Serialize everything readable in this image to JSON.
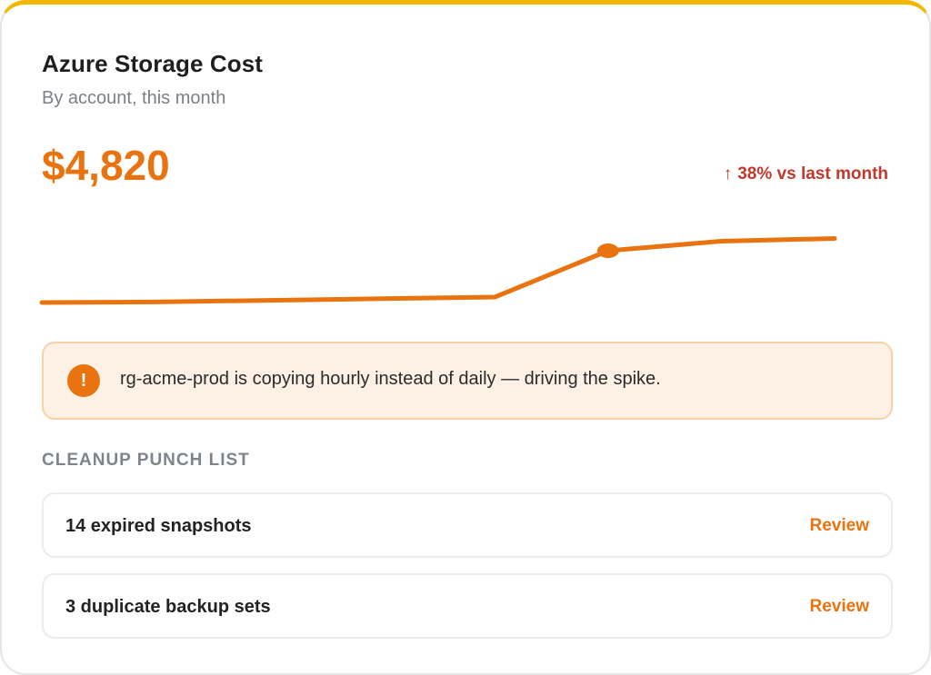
{
  "card": {
    "title": "Azure Storage Cost",
    "subtitle": "By account, this month",
    "total": "$4,820",
    "delta_arrow": "↑",
    "delta_text": "38% vs last month",
    "accent_color": "#e8730f",
    "top_border_color": "#f2b705",
    "delta_color": "#c0392b"
  },
  "alert": {
    "icon": "exclamation-icon",
    "text": "rg-acme-prod is copying hourly instead of daily — driving the spike."
  },
  "punch_list": {
    "heading": "CLEANUP PUNCH LIST",
    "items": [
      {
        "label": "14 expired snapshots",
        "action": "Review"
      },
      {
        "label": "3 duplicate backup sets",
        "action": "Review"
      }
    ]
  },
  "chart_data": {
    "type": "line",
    "x": [
      1,
      2,
      3,
      4,
      5,
      6,
      7,
      8
    ],
    "values": [
      4.0,
      4.2,
      4.8,
      5.4,
      6.0,
      23.0,
      26.5,
      27.5
    ],
    "ylim": [
      0,
      40
    ],
    "highlight_index": 5,
    "grid": false,
    "title": "",
    "xlabel": "",
    "ylabel": ""
  }
}
